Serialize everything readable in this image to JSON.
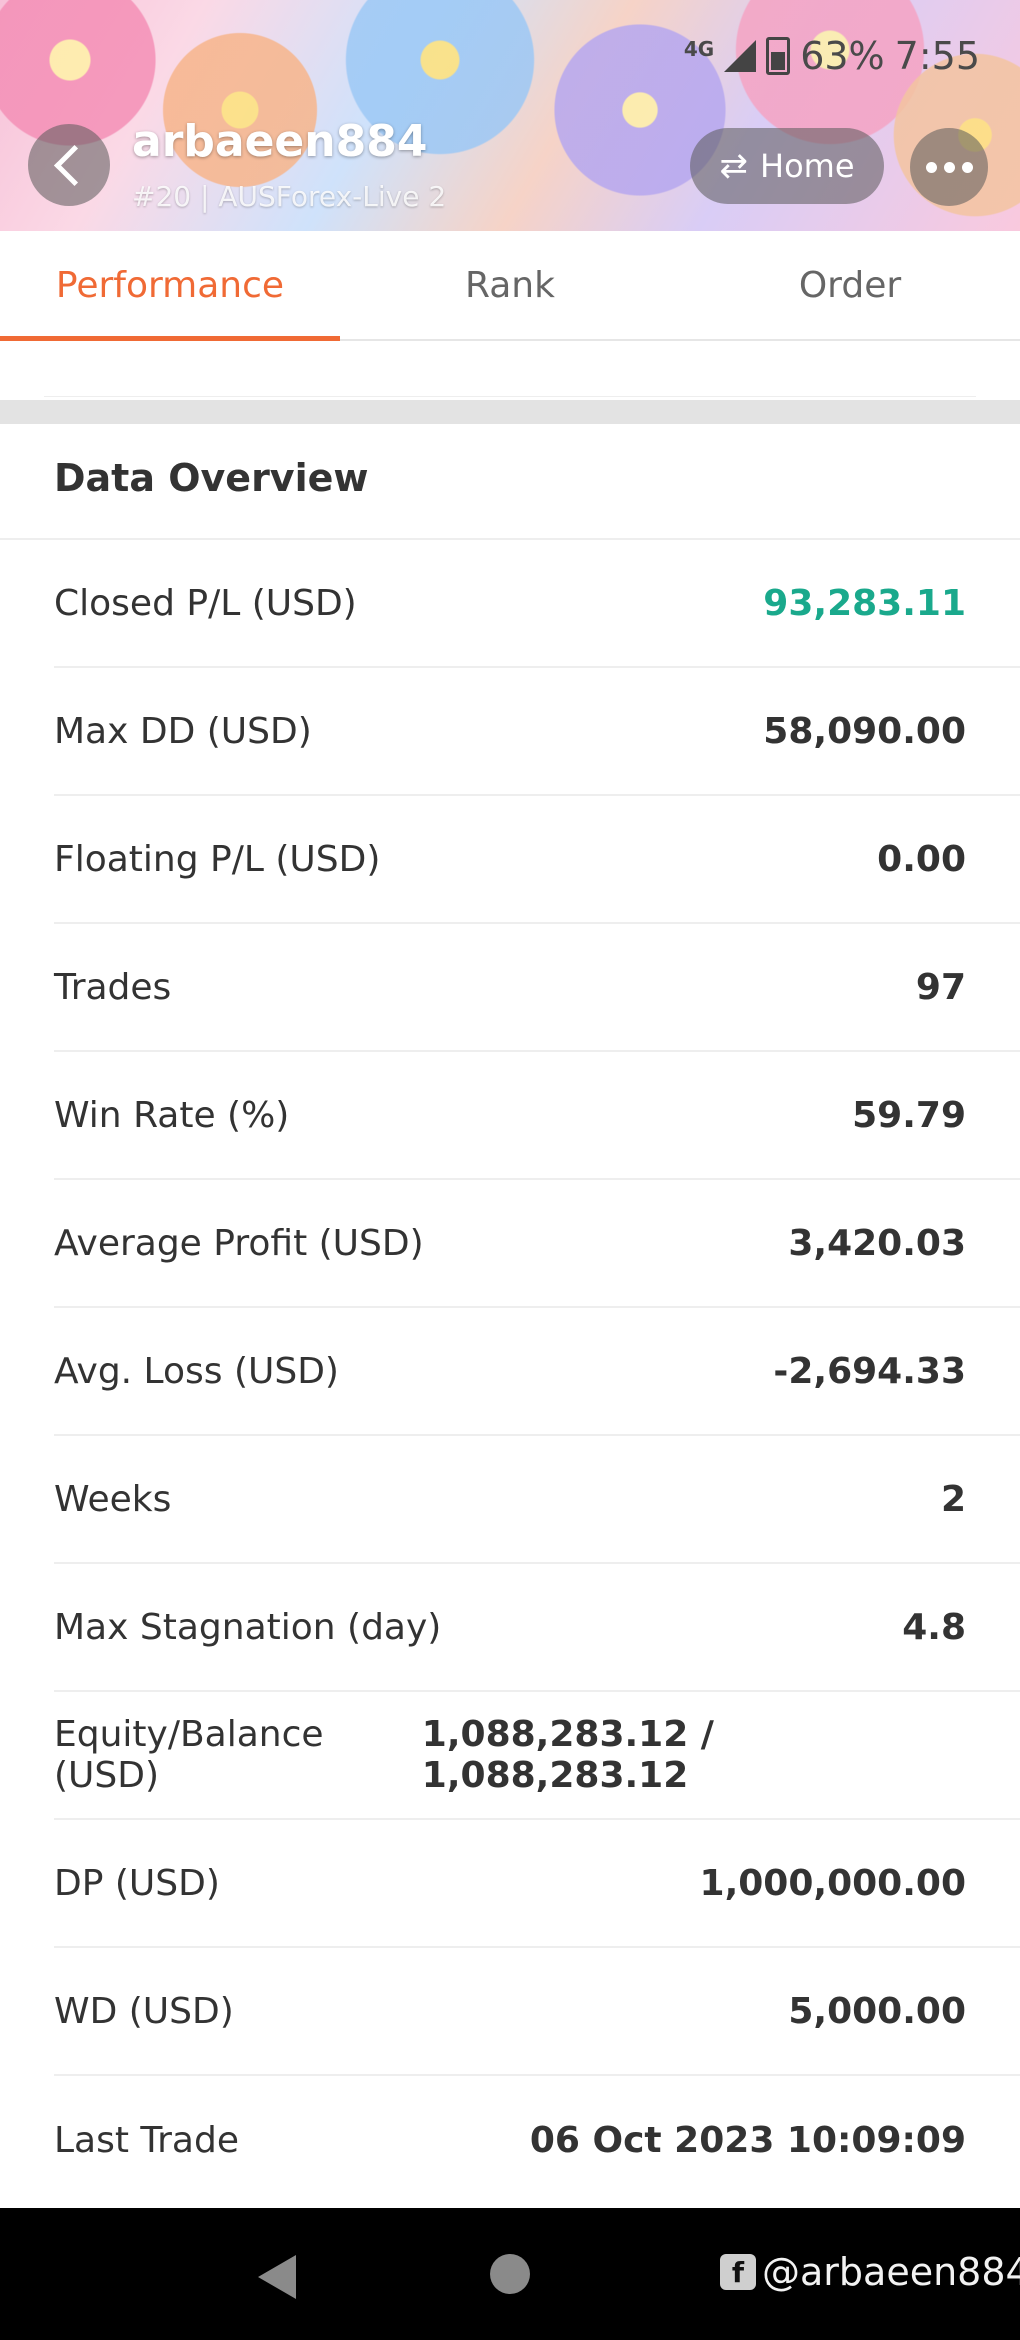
{
  "status_bar": {
    "network": "4G",
    "battery": "63%",
    "time": "7:55"
  },
  "header": {
    "account_name": "arbaeen884",
    "account_sub": "#20 | AUSForex-Live 2",
    "home_label": "Home",
    "icons": {
      "back": "chevron-left-icon",
      "swap": "swap-arrows-icon",
      "more": "more-dots-icon"
    }
  },
  "tabs": [
    {
      "label": "Performance",
      "active": true
    },
    {
      "label": "Rank",
      "active": false
    },
    {
      "label": "Order",
      "active": false
    }
  ],
  "overview": {
    "title": "Data Overview",
    "rows": [
      {
        "label": "Closed P/L (USD)",
        "value": "93,283.11"
      },
      {
        "label": "Max DD (USD)",
        "value": "58,090.00"
      },
      {
        "label": "Floating P/L (USD)",
        "value": "0.00"
      },
      {
        "label": "Trades",
        "value": "97"
      },
      {
        "label": "Win Rate (%)",
        "value": "59.79"
      },
      {
        "label": "Average Profit (USD)",
        "value": "3,420.03"
      },
      {
        "label": "Avg. Loss (USD)",
        "value": "-2,694.33"
      },
      {
        "label": "Weeks",
        "value": "2"
      },
      {
        "label": "Max Stagnation (day)",
        "value": "4.8"
      },
      {
        "label": "Equity/Balance (USD)",
        "value": "1,088,283.12 / 1,088,283.12"
      },
      {
        "label": "DP (USD)",
        "value": "1,000,000.00"
      },
      {
        "label": "WD (USD)",
        "value": "5,000.00"
      },
      {
        "label": "Last Trade",
        "value": "06 Oct 2023 10:09:09"
      }
    ]
  },
  "colors": {
    "accent": "#f06a35",
    "positive": "#1aa98c"
  },
  "watermark": {
    "text": "@arbaeen884",
    "icon": "facebook-icon"
  }
}
